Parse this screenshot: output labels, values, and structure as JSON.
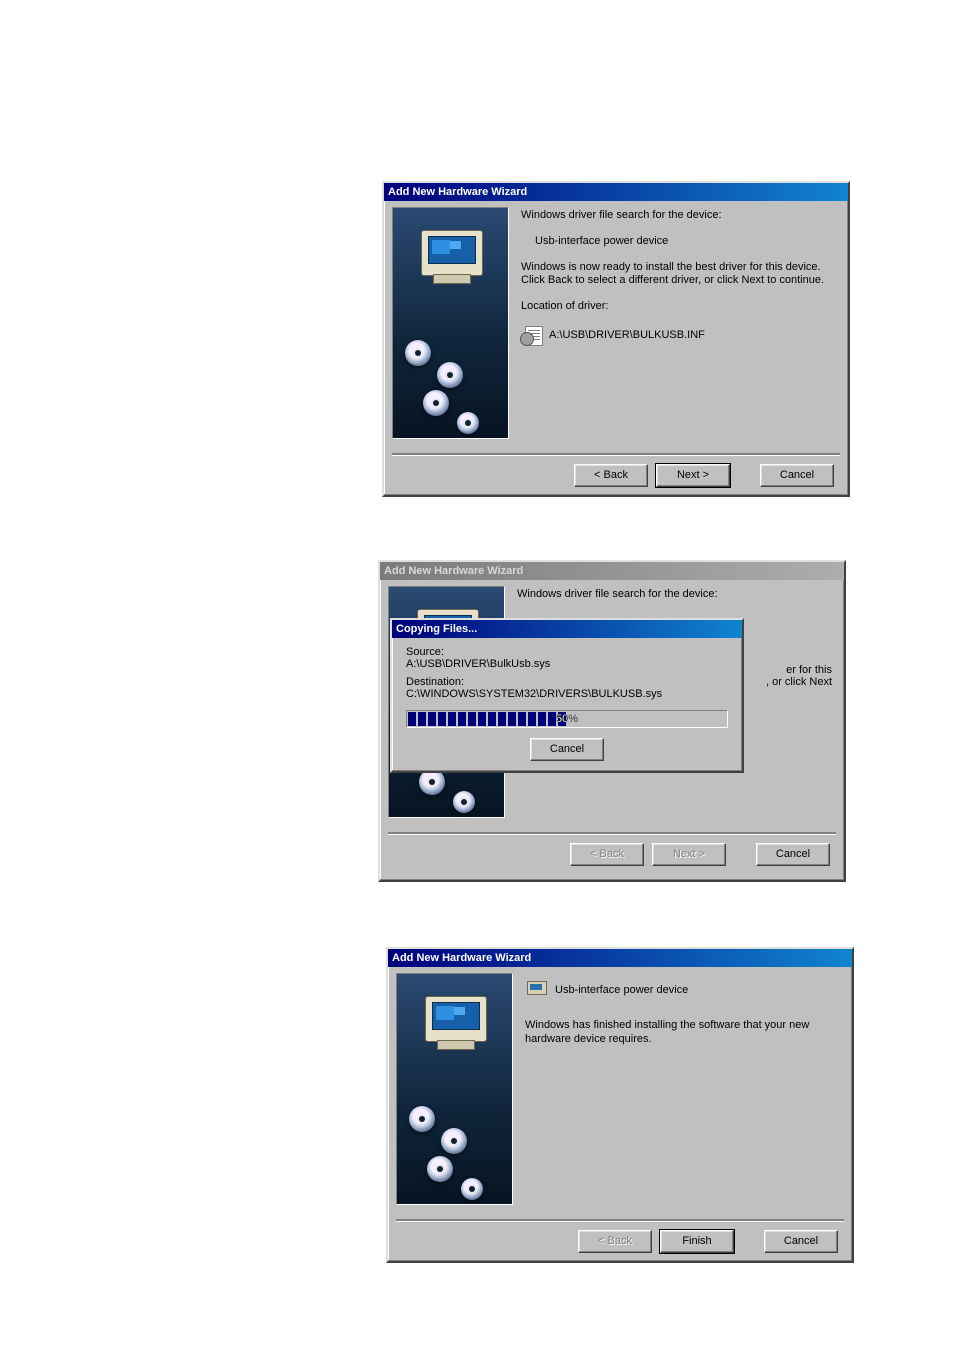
{
  "common": {
    "wizard_title": "Add New Hardware Wizard",
    "back_label": "< Back",
    "next_label": "Next >",
    "cancel_label": "Cancel",
    "finish_label": "Finish",
    "back_label_plain": "< Back"
  },
  "step_ready": {
    "heading": "Windows driver file search for the device:",
    "device_name": "Usb-interface power device",
    "ready_text": "Windows is now ready to install the best driver for this device. Click Back to select a different driver, or click Next to continue.",
    "location_label": "Location of driver:",
    "driver_path": "A:\\USB\\DRIVER\\BULKUSB.INF"
  },
  "copying": {
    "popup_title": "Copying Files...",
    "source_label": "Source:",
    "source_value": "A:\\USB\\DRIVER\\BulkUsb.sys",
    "dest_label": "Destination:",
    "dest_value": "C:\\WINDOWS\\SYSTEM32\\DRIVERS\\BULKUSB.sys",
    "progress_percent": 50,
    "progress_label": "50%",
    "cancel_label": "Cancel",
    "bg_heading": "Windows driver file search for the device:",
    "bg_partial_right_1": "er for this",
    "bg_partial_right_2": ", or click Next"
  },
  "step_done": {
    "device_name": "Usb-interface power device",
    "finished_text": "Windows has finished installing the software that your new hardware device requires."
  }
}
